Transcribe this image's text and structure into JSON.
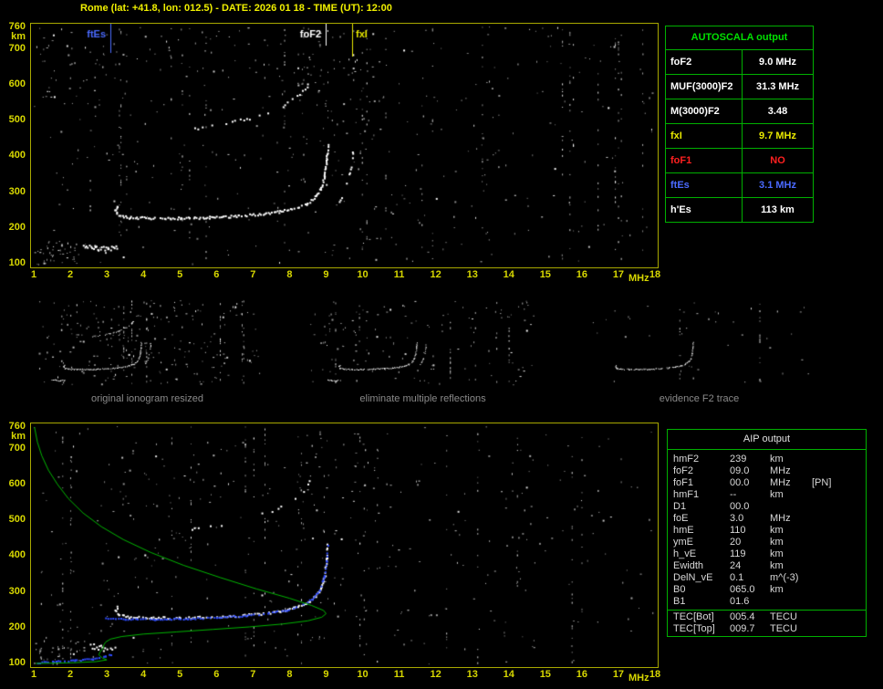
{
  "title": "Rome (lat: +41.8, lon: 012.5) - DATE: 2026 01 18 - TIME (UT): 12:00",
  "colors": {
    "axis_labels": "#d8d800",
    "plot_border": "#a8a800",
    "table_green": "#00b000",
    "autoscala_title_green": "#00e000",
    "caption_gray": "#8a8a8a",
    "trace_white": "#ffffff",
    "fitted_blue": "#2e4bff",
    "profile_green": "#00b400",
    "ftEs_blue": "#4a6aff",
    "fxI_yellow": "#e8e800",
    "foF1_red": "#ff2020"
  },
  "autoscala_table": {
    "title": "AUTOSCALA output",
    "rows": [
      {
        "label": "foF2",
        "value": "9.0 MHz",
        "color": "#ffffff"
      },
      {
        "label": "MUF(3000)F2",
        "value": "31.3 MHz",
        "color": "#ffffff"
      },
      {
        "label": "M(3000)F2",
        "value": "3.48",
        "color": "#ffffff"
      },
      {
        "label": "fxI",
        "value": "9.7 MHz",
        "color": "#e8e800"
      },
      {
        "label": "foF1",
        "value": "NO",
        "color": "#ff2020"
      },
      {
        "label": "ftEs",
        "value": "3.1 MHz",
        "color": "#4a6aff"
      },
      {
        "label": "h'Es",
        "value": "113   km",
        "color": "#ffffff"
      }
    ]
  },
  "aip_table": {
    "title": "AIP output",
    "rows": [
      {
        "label": "hmF2",
        "value": "239",
        "unit": "km",
        "note": ""
      },
      {
        "label": "foF2",
        "value": "09.0",
        "unit": "MHz",
        "note": ""
      },
      {
        "label": "foF1",
        "value": "00.0",
        "unit": "MHz",
        "note": "[PN]"
      },
      {
        "label": "hmF1",
        "value": "--",
        "unit": "km",
        "note": ""
      },
      {
        "label": "D1",
        "value": "00.0",
        "unit": "",
        "note": ""
      },
      {
        "label": "foE",
        "value": "3.0",
        "unit": "MHz",
        "note": ""
      },
      {
        "label": "hmE",
        "value": "110",
        "unit": "km",
        "note": ""
      },
      {
        "label": "ymE",
        "value": "20",
        "unit": "km",
        "note": ""
      },
      {
        "label": "h_vE",
        "value": "119",
        "unit": "km",
        "note": ""
      },
      {
        "label": "Ewidth",
        "value": "24",
        "unit": "km",
        "note": ""
      },
      {
        "label": "DelN_vE",
        "value": "0.1",
        "unit": "m^(-3)",
        "note": ""
      },
      {
        "label": "B0",
        "value": "065.0",
        "unit": "km",
        "note": ""
      },
      {
        "label": "B1",
        "value": "01.6",
        "unit": "",
        "note": ""
      }
    ],
    "tec_rows": [
      {
        "label": "TEC[Bot]",
        "value": "005.4",
        "unit": "TECU",
        "note": ""
      },
      {
        "label": "TEC[Top]",
        "value": "009.7",
        "unit": "TECU",
        "note": ""
      }
    ]
  },
  "thumbnails": [
    {
      "caption": "original ionogram resized"
    },
    {
      "caption": "eliminate multiple reflections"
    },
    {
      "caption": "evidence F2 trace"
    }
  ],
  "chart_data": [
    {
      "id": "main_ionogram",
      "type": "scatter",
      "xlabel": "MHz",
      "ylabel": "km",
      "xlim": [
        1,
        18
      ],
      "ylim": [
        100,
        760
      ],
      "xticks": [
        1,
        2,
        3,
        4,
        5,
        6,
        7,
        8,
        9,
        10,
        11,
        12,
        13,
        14,
        15,
        16,
        17,
        18
      ],
      "yticks": [
        100,
        200,
        300,
        400,
        500,
        600,
        700,
        760
      ],
      "markers": [
        {
          "label": "ftEs",
          "freq_mhz": 3.1,
          "color": "#4a6aff",
          "line_len": 32,
          "side": "left"
        },
        {
          "label": "foF2",
          "freq_mhz": 9.0,
          "color": "#ffffff",
          "line_len": 24,
          "side": "left"
        },
        {
          "label": "fxI",
          "freq_mhz": 9.7,
          "color": "#e8e800",
          "line_len": 36,
          "side": "right"
        }
      ],
      "traces": [
        {
          "name": "F2-ordinary",
          "color": "#ffffff",
          "style": {
            "size": 2,
            "step": 2.0,
            "jx": 1.6,
            "jy": 2.6,
            "density": 0.92
          },
          "points": [
            [
              3.28,
              262
            ],
            [
              3.22,
              250
            ],
            [
              3.3,
              237
            ],
            [
              3.6,
              231
            ],
            [
              4.2,
              229
            ],
            [
              5.0,
              229
            ],
            [
              5.8,
              231
            ],
            [
              6.6,
              235
            ],
            [
              7.2,
              240
            ],
            [
              7.7,
              247
            ],
            [
              8.1,
              256
            ],
            [
              8.45,
              269
            ],
            [
              8.7,
              288
            ],
            [
              8.85,
              312
            ],
            [
              8.95,
              348
            ],
            [
              9.0,
              392
            ],
            [
              9.03,
              432
            ]
          ]
        },
        {
          "name": "F2-extraordinary",
          "color": "#ffffff",
          "style": {
            "size": 2,
            "step": 2.6,
            "jx": 1.4,
            "jy": 2.4,
            "density": 0.5
          },
          "points": [
            [
              9.22,
              258
            ],
            [
              9.38,
              280
            ],
            [
              9.52,
              310
            ],
            [
              9.63,
              350
            ],
            [
              9.7,
              398
            ],
            [
              9.73,
              428
            ]
          ]
        },
        {
          "name": "F2-multiple-hop",
          "color": "#ffffff",
          "style": {
            "size": 2,
            "step": 3.4,
            "jx": 2,
            "jy": 3,
            "density": 0.45
          },
          "points": [
            [
              5.3,
              478
            ],
            [
              6.1,
              490
            ],
            [
              6.9,
              507
            ],
            [
              7.5,
              528
            ],
            [
              8.0,
              553
            ],
            [
              8.35,
              582
            ],
            [
              8.55,
              610
            ]
          ]
        },
        {
          "name": "Es",
          "color": "#ffffff",
          "style": {
            "size": 2,
            "step": 1.5,
            "jx": 1.4,
            "jy": 5,
            "density": 0.95
          },
          "points": [
            [
              2.35,
              152
            ],
            [
              2.65,
              146
            ],
            [
              3.0,
              143
            ],
            [
              3.3,
              147
            ]
          ]
        }
      ],
      "noise": {
        "uniform": 360,
        "streaks": 26,
        "clusters": [
          {
            "f": [
              1.0,
              2.3
            ],
            "km": [
              100,
              168
            ],
            "n": 45
          },
          {
            "f": [
              1.0,
              3.5
            ],
            "km": [
              540,
              760
            ],
            "n": 40
          },
          {
            "f": [
              8.2,
              10.5
            ],
            "km": [
              430,
              760
            ],
            "n": 55
          },
          {
            "f": [
              4.0,
              8.0
            ],
            "km": [
              620,
              760
            ],
            "n": 30
          }
        ]
      }
    },
    {
      "id": "profile_plot",
      "type": "scatter",
      "xlabel": "MHz",
      "ylabel": "km",
      "xlim": [
        1,
        18
      ],
      "ylim": [
        100,
        760
      ],
      "xticks": [
        1,
        2,
        3,
        4,
        5,
        6,
        7,
        8,
        9,
        10,
        11,
        12,
        13,
        14,
        15,
        16,
        17,
        18
      ],
      "yticks": [
        100,
        200,
        300,
        400,
        500,
        600,
        700,
        760
      ],
      "markers": [],
      "traces": [
        {
          "name": "restored-F2",
          "color": "#ffffff",
          "style": {
            "size": 2,
            "step": 2.1,
            "jx": 1.6,
            "jy": 2.4,
            "density": 0.85
          },
          "points": [
            [
              3.28,
              262
            ],
            [
              3.22,
              250
            ],
            [
              3.3,
              237
            ],
            [
              3.6,
              231
            ],
            [
              4.2,
              229
            ],
            [
              5.0,
              229
            ],
            [
              5.8,
              231
            ],
            [
              6.6,
              235
            ],
            [
              7.2,
              240
            ],
            [
              7.7,
              247
            ],
            [
              8.1,
              256
            ],
            [
              8.45,
              269
            ],
            [
              8.7,
              288
            ],
            [
              8.85,
              312
            ],
            [
              8.95,
              348
            ],
            [
              9.0,
              392
            ],
            [
              9.03,
              432
            ]
          ]
        },
        {
          "name": "multiple-hop-residual",
          "color": "#ffffff",
          "style": {
            "size": 2,
            "step": 3.6,
            "jx": 2,
            "jy": 3,
            "density": 0.35
          },
          "points": [
            [
              5.3,
              478
            ],
            [
              6.1,
              490
            ],
            [
              6.9,
              507
            ],
            [
              7.5,
              528
            ],
            [
              8.0,
              553
            ],
            [
              8.35,
              582
            ],
            [
              8.55,
              610
            ]
          ]
        },
        {
          "name": "Es-blob",
          "color": "#ffffff",
          "style": {
            "size": 2,
            "step": 1.6,
            "jx": 1.5,
            "jy": 6,
            "density": 0.9
          },
          "points": [
            [
              2.5,
              152
            ],
            [
              2.85,
              145
            ],
            [
              3.2,
              140
            ]
          ]
        },
        {
          "name": "fitted-F2",
          "color": "#2e4bff",
          "style": {
            "size": 2,
            "step": 2.6,
            "jx": 1.0,
            "jy": 1.6,
            "density": 0.8
          },
          "points": [
            [
              2.95,
              227
            ],
            [
              3.5,
              225
            ],
            [
              4.3,
              225
            ],
            [
              5.2,
              227
            ],
            [
              6.0,
              230
            ],
            [
              6.8,
              235
            ],
            [
              7.4,
              242
            ],
            [
              7.9,
              251
            ],
            [
              8.3,
              263
            ],
            [
              8.6,
              281
            ],
            [
              8.8,
              306
            ],
            [
              8.93,
              342
            ],
            [
              9.0,
              388
            ],
            [
              9.03,
              430
            ]
          ]
        },
        {
          "name": "fitted-E",
          "color": "#2e4bff",
          "style": {
            "size": 2,
            "step": 2.2,
            "jx": 1.0,
            "jy": 1.6,
            "density": 0.85
          },
          "points": [
            [
              1.1,
              104
            ],
            [
              1.6,
              107
            ],
            [
              2.1,
              110
            ],
            [
              2.6,
              114
            ],
            [
              2.95,
              120
            ],
            [
              3.1,
              127
            ]
          ]
        },
        {
          "name": "electron-density-profile",
          "color": "#00b400",
          "draw": "line",
          "points": [
            [
              1.02,
              760
            ],
            [
              1.1,
              718
            ],
            [
              1.22,
              680
            ],
            [
              1.4,
              640
            ],
            [
              1.65,
              600
            ],
            [
              1.95,
              560
            ],
            [
              2.35,
              520
            ],
            [
              2.85,
              482
            ],
            [
              3.45,
              446
            ],
            [
              4.2,
              410
            ],
            [
              5.1,
              374
            ],
            [
              6.1,
              340
            ],
            [
              7.1,
              308
            ],
            [
              8.0,
              282
            ],
            [
              8.6,
              262
            ],
            [
              8.93,
              248
            ],
            [
              9.0,
              239
            ],
            [
              8.88,
              229
            ],
            [
              8.5,
              219
            ],
            [
              7.8,
              210
            ],
            [
              6.9,
              202
            ],
            [
              5.9,
              195
            ],
            [
              4.9,
              188
            ],
            [
              4.0,
              182
            ],
            [
              3.4,
              175
            ],
            [
              3.1,
              168
            ],
            [
              2.97,
              160
            ],
            [
              2.92,
              152
            ],
            [
              2.9,
              143
            ],
            [
              2.82,
              133
            ],
            [
              2.78,
              124
            ],
            [
              2.88,
              115
            ],
            [
              3.0,
              110
            ],
            [
              2.7,
              105
            ],
            [
              2.1,
              102
            ],
            [
              1.4,
              100.5
            ],
            [
              1.05,
              100
            ]
          ]
        }
      ],
      "noise": {
        "uniform": 320,
        "streaks": 22,
        "clusters": [
          {
            "f": [
              1.0,
              2.4
            ],
            "km": [
              100,
              170
            ],
            "n": 35
          },
          {
            "f": [
              8.2,
              10.5
            ],
            "km": [
              430,
              760
            ],
            "n": 45
          },
          {
            "f": [
              3.0,
              6.5
            ],
            "km": [
              480,
              700
            ],
            "n": 30
          }
        ]
      }
    },
    {
      "id": "thumb_original",
      "type": "scatter",
      "render": "thumb",
      "use": "main_ionogram",
      "seed": 101,
      "traces": [
        "F2-ordinary",
        "F2-extraordinary",
        "F2-multiple-hop",
        "Es"
      ],
      "noise": {
        "uniform": 220,
        "streaks": 10
      }
    },
    {
      "id": "thumb_cleaned",
      "type": "scatter",
      "render": "thumb",
      "use": "main_ionogram",
      "seed": 102,
      "traces": [
        "F2-ordinary",
        "F2-extraordinary",
        "Es"
      ],
      "noise": {
        "uniform": 130,
        "streaks": 6
      }
    },
    {
      "id": "thumb_f2",
      "type": "scatter",
      "render": "thumb",
      "use": "main_ionogram",
      "seed": 103,
      "traces": [
        "F2-ordinary"
      ],
      "noise": {
        "uniform": 40,
        "streaks": 2
      }
    }
  ]
}
